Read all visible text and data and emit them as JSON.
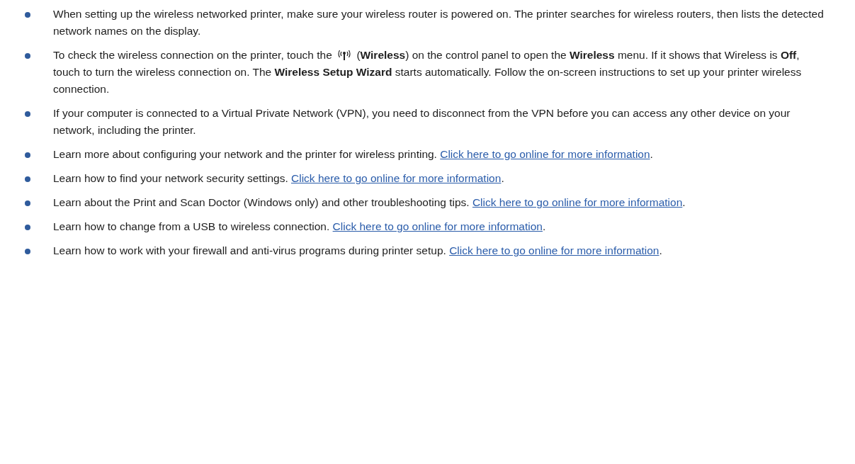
{
  "items": [
    {
      "kind": "text",
      "text": "When setting up the wireless networked printer, make sure your wireless router is powered on. The printer searches for wireless routers, then lists the detected network names on the display."
    },
    {
      "kind": "icon",
      "text": "To check the wireless connection on the printer, touch the",
      "text_after": " (**Wireless**) on the control panel to open the **Wireless** menu. If it shows that Wireless is **Off**, touch to turn the wireless connection on. The **Wireless Setup Wizard** starts automatically. Follow the on-screen instructions to set up your printer wireless connection."
    },
    {
      "kind": "text",
      "text": "If your computer is connected to a Virtual Private Network (VPN), you need to disconnect from the VPN before you can access any other device on your network, including the printer."
    },
    {
      "kind": "text",
      "text": "Learn more about configuring your network and the printer for wireless printing. ",
      "link": "Click here to go online for more information",
      "after": "."
    },
    {
      "kind": "text",
      "text": "Learn how to find your network security settings. ",
      "link": "Click here to go online for more information",
      "after": "."
    },
    {
      "kind": "text",
      "text": "Learn about the Print and Scan Doctor (Windows only) and other troubleshooting tips. ",
      "link": "Click here to go online for more information",
      "after": "."
    },
    {
      "kind": "text",
      "text": "Learn how to change from a USB to wireless connection. ",
      "link": "Click here to go online for more information",
      "after": "."
    },
    {
      "kind": "text",
      "text": "Learn how to work with your firewall and anti-virus programs during printer setup. ",
      "link": "Click here to go online for more information",
      "after": "."
    }
  ]
}
